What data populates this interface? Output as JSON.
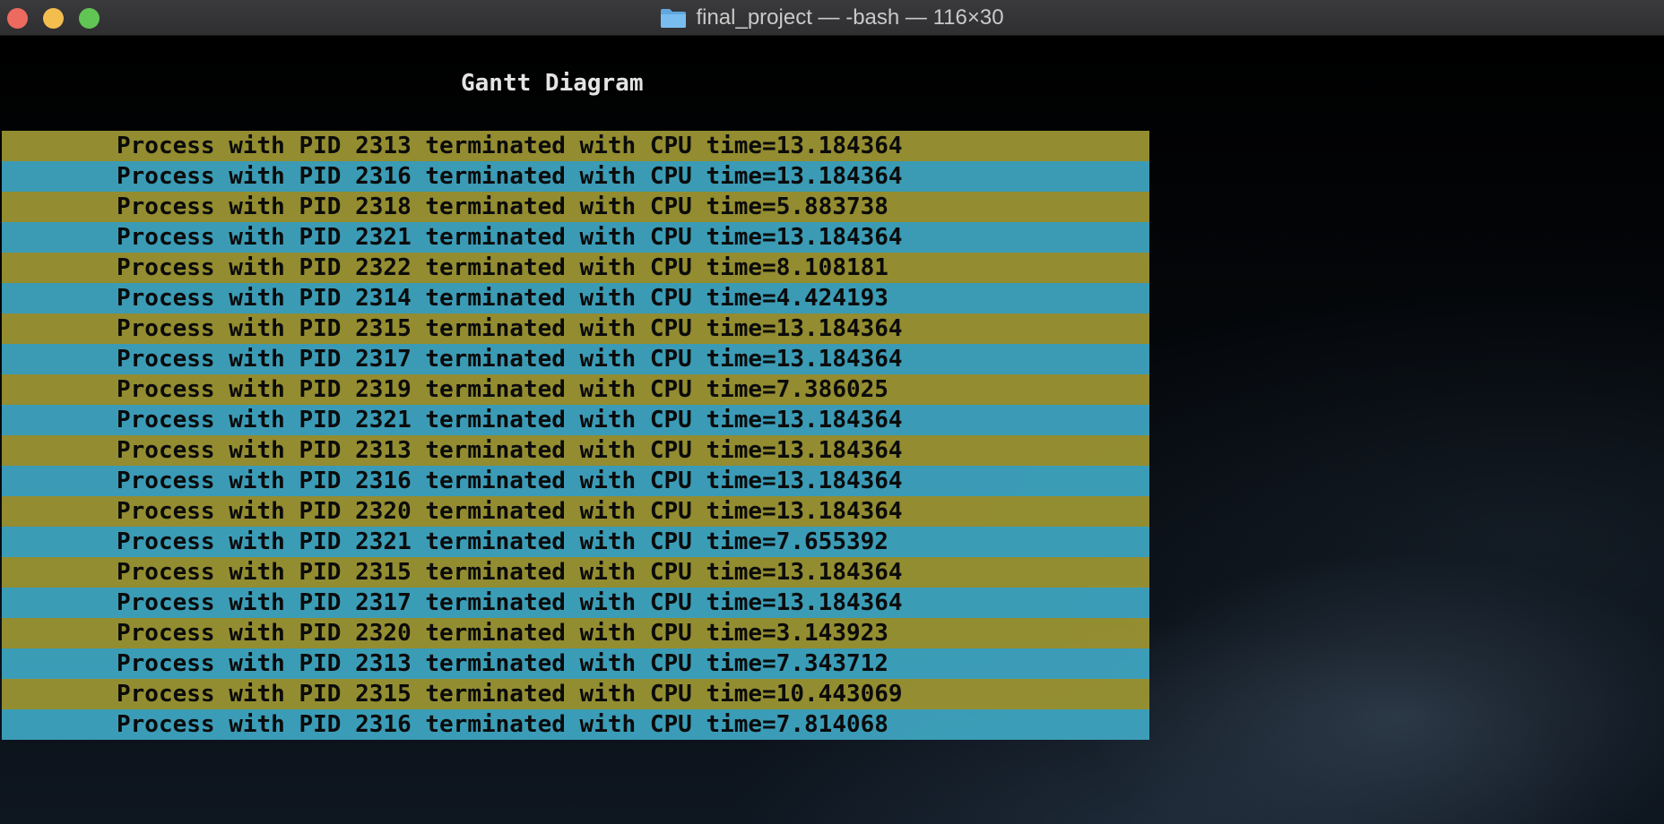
{
  "window": {
    "title": "final_project — -bash — 116×30"
  },
  "colors": {
    "row_even": "#a09834",
    "row_odd": "#40a8c4",
    "text": "#0b0b0b"
  },
  "terminal": {
    "heading": "Gantt Diagram",
    "rows": [
      "Process with PID 2313 terminated with CPU time=13.184364",
      "Process with PID 2316 terminated with CPU time=13.184364",
      "Process with PID 2318 terminated with CPU time=5.883738",
      "Process with PID 2321 terminated with CPU time=13.184364",
      "Process with PID 2322 terminated with CPU time=8.108181",
      "Process with PID 2314 terminated with CPU time=4.424193",
      "Process with PID 2315 terminated with CPU time=13.184364",
      "Process with PID 2317 terminated with CPU time=13.184364",
      "Process with PID 2319 terminated with CPU time=7.386025",
      "Process with PID 2321 terminated with CPU time=13.184364",
      "Process with PID 2313 terminated with CPU time=13.184364",
      "Process with PID 2316 terminated with CPU time=13.184364",
      "Process with PID 2320 terminated with CPU time=13.184364",
      "Process with PID 2321 terminated with CPU time=7.655392",
      "Process with PID 2315 terminated with CPU time=13.184364",
      "Process with PID 2317 terminated with CPU time=13.184364",
      "Process with PID 2320 terminated with CPU time=3.143923",
      "Process with PID 2313 terminated with CPU time=7.343712",
      "Process with PID 2315 terminated with CPU time=10.443069",
      "Process with PID 2316 terminated with CPU time=7.814068"
    ]
  }
}
